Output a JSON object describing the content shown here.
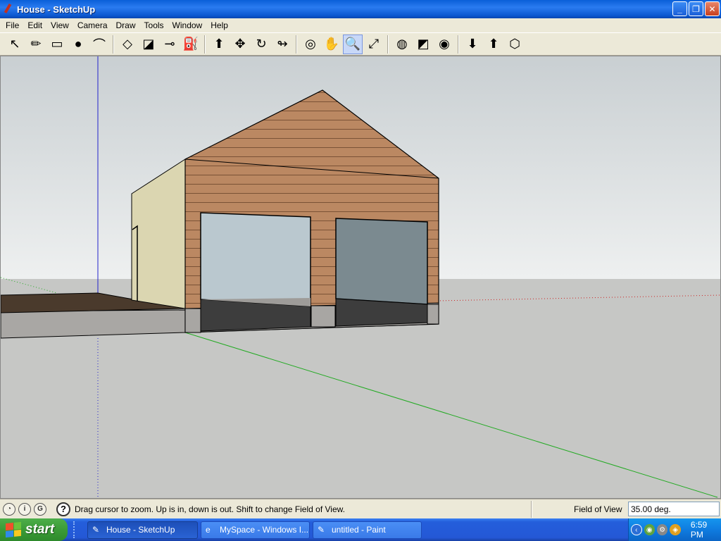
{
  "window": {
    "title": "House - SketchUp",
    "controls": {
      "minimize": "_",
      "maximize": "❐",
      "close": "✕"
    }
  },
  "menu": {
    "items": [
      "File",
      "Edit",
      "View",
      "Camera",
      "Draw",
      "Tools",
      "Window",
      "Help"
    ]
  },
  "toolbar": {
    "tools": [
      {
        "name": "select-tool",
        "icon": "↖",
        "group": 1
      },
      {
        "name": "pencil-tool",
        "icon": "✏",
        "group": 1
      },
      {
        "name": "rectangle-tool",
        "icon": "▭",
        "group": 1
      },
      {
        "name": "circle-tool",
        "icon": "●",
        "group": 1
      },
      {
        "name": "arc-tool",
        "icon": "⌒",
        "group": 1
      },
      {
        "name": "make-component-tool",
        "icon": "◇",
        "group": 2
      },
      {
        "name": "eraser-tool",
        "icon": "◪",
        "group": 2
      },
      {
        "name": "tape-measure-tool",
        "icon": "⊸",
        "group": 2
      },
      {
        "name": "paint-bucket-tool",
        "icon": "⛽",
        "group": 2
      },
      {
        "name": "push-pull-tool",
        "icon": "⬆",
        "group": 3
      },
      {
        "name": "move-tool",
        "icon": "✥",
        "group": 3
      },
      {
        "name": "rotate-tool",
        "icon": "↻",
        "group": 3
      },
      {
        "name": "follow-me-tool",
        "icon": "↬",
        "group": 3
      },
      {
        "name": "orbit-tool",
        "icon": "◎",
        "group": 4
      },
      {
        "name": "pan-tool",
        "icon": "✋",
        "group": 4
      },
      {
        "name": "zoom-tool",
        "icon": "🔍",
        "group": 4,
        "active": true
      },
      {
        "name": "zoom-extents-tool",
        "icon": "⤢",
        "group": 4
      },
      {
        "name": "get-current-view-tool",
        "icon": "◍",
        "group": 5
      },
      {
        "name": "toggle-terrain-tool",
        "icon": "◩",
        "group": 5
      },
      {
        "name": "place-model-tool",
        "icon": "◉",
        "group": 5
      },
      {
        "name": "get-models-tool",
        "icon": "⬇",
        "group": 6
      },
      {
        "name": "share-model-tool",
        "icon": "⬆",
        "group": 6
      },
      {
        "name": "share-component-tool",
        "icon": "⬡",
        "group": 6
      }
    ]
  },
  "colors": {
    "sky": "#cfd4d6",
    "ground": "#c5c6c4",
    "siding": "#b9855f",
    "side_wall": "#dcd7b0",
    "door_left": "#b9c7cf",
    "door_right": "#7b8a90",
    "x_axis": "#cc2222",
    "y_axis": "#22aa22",
    "z_axis": "#2222cc"
  },
  "status": {
    "instruction": "Drag cursor to zoom.  Up is in, down is out. Shift to change Field of View.",
    "fov_label": "Field of View",
    "fov_value": "35.00 deg."
  },
  "taskbar": {
    "start_label": "start",
    "tasks": [
      {
        "label": "House - SketchUp",
        "icon": "✎",
        "active": true
      },
      {
        "label": "MySpace - Windows I...",
        "icon": "e",
        "active": false
      },
      {
        "label": "untitled - Paint",
        "icon": "✎",
        "active": false
      }
    ],
    "clock": "6:59 PM"
  }
}
